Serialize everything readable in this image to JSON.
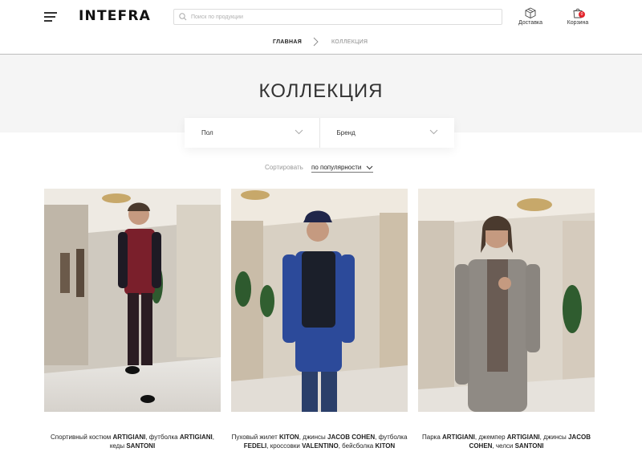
{
  "header": {
    "logo": "INTEFRA",
    "search_placeholder": "Поиск по продукции",
    "delivery_label": "Доставка",
    "cart_label": "Корзина",
    "cart_count": "0"
  },
  "breadcrumb": {
    "home": "ГЛАВНАЯ",
    "current": "КОЛЛЕКЦИЯ"
  },
  "page_title": "КОЛЛЕКЦИЯ",
  "filters": {
    "gender_label": "Пол",
    "brand_label": "Бренд"
  },
  "sort": {
    "label": "Сортировать",
    "value": "по популярности"
  },
  "products": [
    {
      "caption_parts": [
        "Спортивный костюм ",
        "ARTIGIANI",
        ", футболка ",
        "ARTIGIANI",
        ", кеды ",
        "SANTONI"
      ]
    },
    {
      "caption_parts": [
        "Пуховый жилет ",
        "KITON",
        ", джинсы ",
        "JACOB COHEN",
        ", футболка ",
        "FEDELI",
        ", кроссовки ",
        "VALENTINO",
        ", бейсболка ",
        "KITON"
      ]
    },
    {
      "caption_parts": [
        "Парка ",
        "ARTIGIANI",
        ", джемпер ",
        "ARTIGIANI",
        ", джинсы ",
        "JACOB COHEN",
        ", челси ",
        "SANTONI"
      ]
    }
  ],
  "icons": {
    "menu": "menu-icon",
    "search": "search-icon",
    "delivery": "box-icon",
    "cart": "shopping-bag-icon",
    "breadcrumb_separator": "chevron-right-icon",
    "dropdown": "chevron-down-icon"
  },
  "colors": {
    "badge": "#e3242b",
    "hero_background": "#f5f5f5"
  }
}
